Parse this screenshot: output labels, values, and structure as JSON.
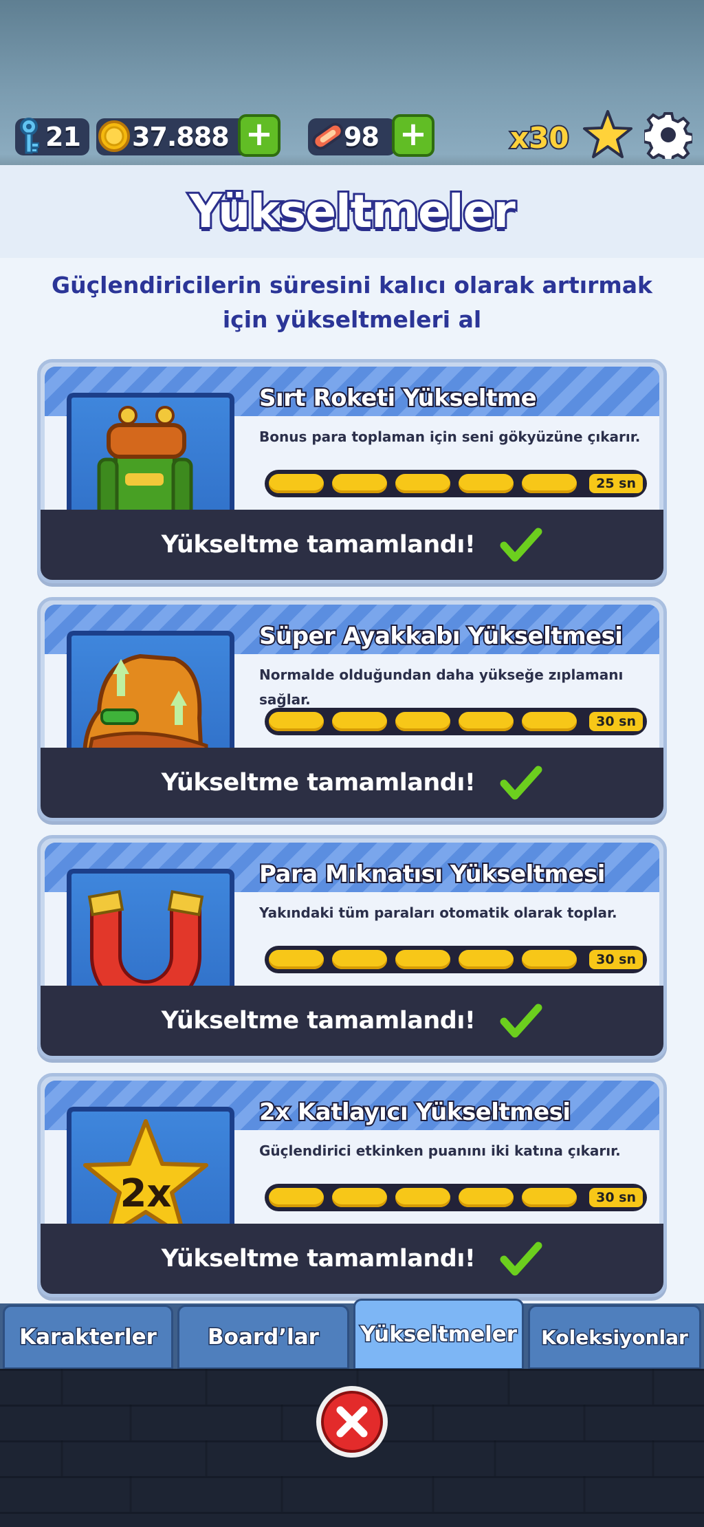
{
  "hud": {
    "keys": "21",
    "coins": "37.888",
    "hoverboards": "98",
    "multiplier": "x30"
  },
  "page_title": "Yükseltmeler",
  "subtitle_line1": "Güçlendiricilerin süresini kalıcı olarak artırmak",
  "subtitle_line2": "için yükseltmeleri al",
  "upgrades": [
    {
      "name": "Sırt Roketi Yükseltme",
      "description": "Bonus para toplaman için seni gökyüzüne çıkarır.",
      "level": 5,
      "max_level": 5,
      "duration": "25 sn",
      "status": "Yükseltme tamamlandı!",
      "icon": "jetpack-icon"
    },
    {
      "name": "Süper Ayakkabı Yükseltmesi",
      "description": "Normalde olduğundan daha yükseğe zıplamanı sağlar.",
      "level": 5,
      "max_level": 5,
      "duration": "30 sn",
      "status": "Yükseltme tamamlandı!",
      "icon": "super-sneakers-icon"
    },
    {
      "name": "Para Mıknatısı Yükseltmesi",
      "description": "Yakındaki tüm paraları otomatik olarak toplar.",
      "level": 5,
      "max_level": 5,
      "duration": "30 sn",
      "status": "Yükseltme tamamlandı!",
      "icon": "coin-magnet-icon"
    },
    {
      "name": "2x Katlayıcı Yükseltmesi",
      "description": "Güçlendirici etkinken puanını iki katına çıkarır.",
      "level": 5,
      "max_level": 5,
      "duration": "30 sn",
      "status": "Yükseltme tamamlandı!",
      "icon": "2x-multiplier-icon",
      "icon_text": "2x"
    }
  ],
  "tabs": [
    {
      "label": "Karakterler",
      "active": false
    },
    {
      "label": "Board’lar",
      "active": false
    },
    {
      "label": "Yükseltmeler",
      "active": true
    },
    {
      "label": "Koleksiyonlar",
      "active": false
    }
  ],
  "colors": {
    "title_stroke": "#2b2f8c",
    "progress_fill": "#f7c718",
    "check_green": "#6ccf1e",
    "plus_green": "#61bd25"
  }
}
